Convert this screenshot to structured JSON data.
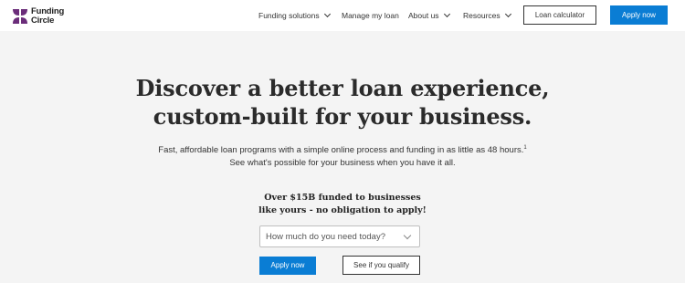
{
  "brand": {
    "name_line1": "Funding",
    "name_line2": "Circle",
    "logo_icon": "funding-circle-logo-icon",
    "logo_color": "#6b2d7a"
  },
  "nav": {
    "items": [
      {
        "label": "Funding solutions",
        "has_dropdown": true
      },
      {
        "label": "Manage my loan",
        "has_dropdown": false
      },
      {
        "label": "About us",
        "has_dropdown": true
      },
      {
        "label": "Resources",
        "has_dropdown": true
      }
    ],
    "loan_calculator_label": "Loan calculator",
    "apply_label": "Apply now"
  },
  "hero": {
    "headline_line1": "Discover a better loan experience,",
    "headline_line2": "custom-built for your business.",
    "sub_line1": "Fast, affordable loan programs with a simple online process and funding in as little as 48 hours.",
    "sub_sup": "1",
    "sub_line2": "See what's possible for your business when you have it all.",
    "promo_line1": "Over $15B funded to businesses",
    "promo_line2": "like yours - no obligation to apply!",
    "select_placeholder": "How much do you need today?",
    "apply_label": "Apply now",
    "qualify_label": "See if you qualify"
  },
  "colors": {
    "accent": "#0a7dd4",
    "background": "#f4f4f4",
    "heading": "#2b2b2b"
  }
}
